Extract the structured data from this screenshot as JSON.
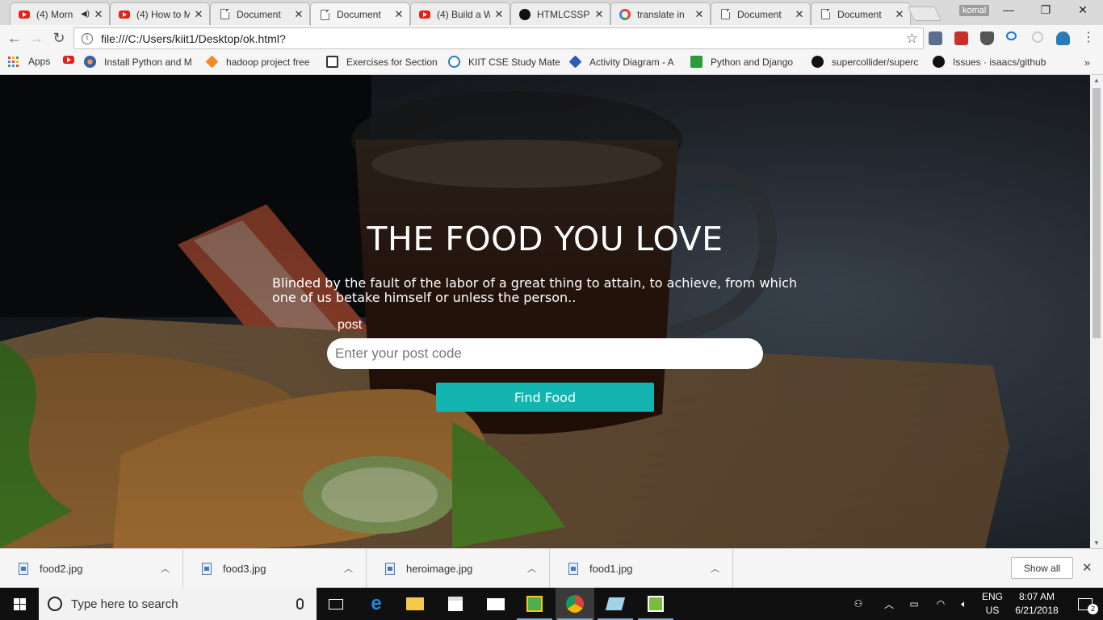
{
  "browser": {
    "tabs": [
      {
        "title": "(4) Morn",
        "favicon": "youtube-icon",
        "audio": true,
        "active": false
      },
      {
        "title": "(4) How to M",
        "favicon": "youtube-icon",
        "audio": false,
        "active": false
      },
      {
        "title": "Document",
        "favicon": "document-icon",
        "audio": false,
        "active": false
      },
      {
        "title": "Document",
        "favicon": "document-icon",
        "audio": false,
        "active": true
      },
      {
        "title": "(4) Build a W",
        "favicon": "youtube-icon",
        "audio": false,
        "active": false
      },
      {
        "title": "HTMLCSSPR",
        "favicon": "github-icon",
        "audio": false,
        "active": false
      },
      {
        "title": "translate in",
        "favicon": "google-icon",
        "audio": false,
        "active": false
      },
      {
        "title": "Document",
        "favicon": "document-icon",
        "audio": false,
        "active": false
      },
      {
        "title": "Document",
        "favicon": "document-icon",
        "audio": false,
        "active": false
      }
    ],
    "profile_name": "komal",
    "url": "file:///C:/Users/kiit1/Desktop/ok.html?",
    "bookmarks": [
      {
        "label": "Apps",
        "icon": "apps-grid-icon"
      },
      {
        "label": "",
        "icon": "youtube-icon"
      },
      {
        "label": "Install Python and M",
        "icon": "python-icon"
      },
      {
        "label": "hadoop project free",
        "icon": "diamond-icon"
      },
      {
        "label": "Exercises for Section",
        "icon": "book-icon"
      },
      {
        "label": "KIIT CSE Study Mate",
        "icon": "wordpress-icon"
      },
      {
        "label": "Activity Diagram - A",
        "icon": "visual-paradigm-icon"
      },
      {
        "label": "Python and Django",
        "icon": "ftu-icon"
      },
      {
        "label": "supercollider/superc",
        "icon": "github-icon"
      },
      {
        "label": "Issues · isaacs/github",
        "icon": "github-icon"
      }
    ],
    "bookmarks_more": "»"
  },
  "page": {
    "hero_title": "THE FOOD YOU LOVE",
    "hero_subtitle": "Blinded by the fault of the labor of a great thing to attain, to achieve, from which one of us betake himself or unless the person..",
    "post_label": "post",
    "post_placeholder": "Enter your post code",
    "find_button": "Find Food"
  },
  "downloads": {
    "items": [
      "food2.jpg",
      "food3.jpg",
      "heroimage.jpg",
      "food1.jpg"
    ],
    "show_all": "Show all"
  },
  "taskbar": {
    "search_placeholder": "Type here to search",
    "lang_line1": "ENG",
    "lang_line2": "US",
    "time": "8:07 AM",
    "date": "6/21/2018",
    "notification_count": "2"
  },
  "colors": {
    "accent_button": "#13b5b0",
    "youtube_red": "#e62117"
  }
}
